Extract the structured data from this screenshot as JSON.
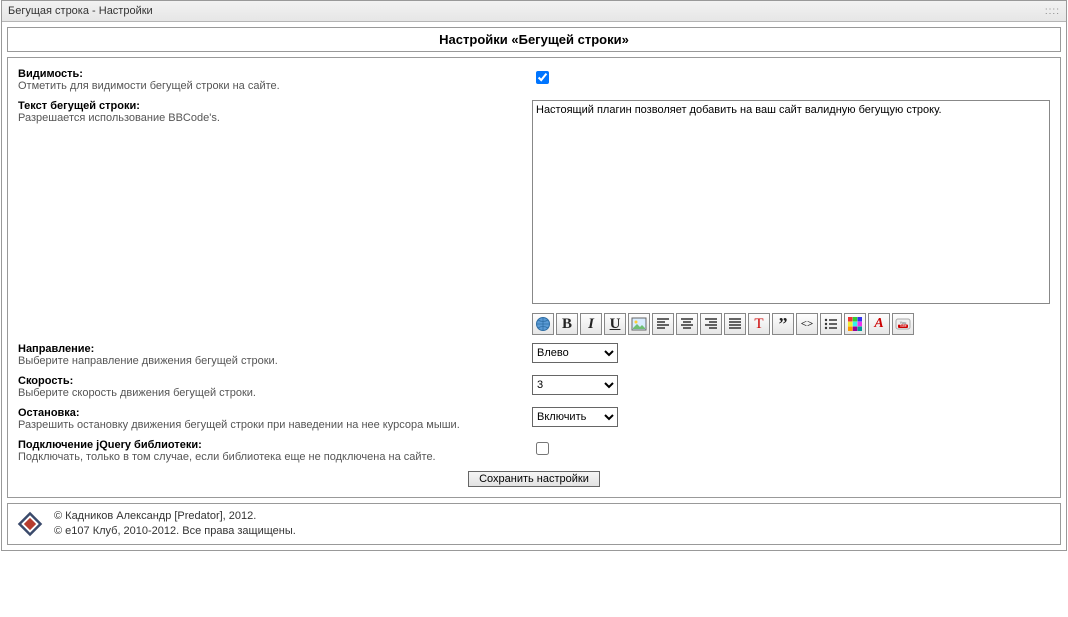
{
  "window": {
    "title": "Бегущая строка - Настройки",
    "handle": "::::"
  },
  "panel": {
    "heading": "Настройки «Бегущей строки»"
  },
  "fields": {
    "visibility": {
      "label": "Видимость:",
      "hint": "Отметить для видимости бегущей строки на сайте.",
      "checked": true
    },
    "text": {
      "label": "Текст бегущей строки:",
      "hint": "Разрешается использование BBCode's.",
      "value": "Настоящий плагин позволяет добавить на ваш сайт валидную бегущую строку."
    },
    "direction": {
      "label": "Направление:",
      "hint": "Выберите направление движения бегущей строки.",
      "value": "Влево"
    },
    "speed": {
      "label": "Скорость:",
      "hint": "Выберите скорость движения бегущей строки.",
      "value": "3"
    },
    "pause": {
      "label": "Остановка:",
      "hint": "Разрешить остановку движения бегущей строки при наведении на нее курсора мыши.",
      "value": "Включить"
    },
    "jquery": {
      "label": "Подключение jQuery библиотеки:",
      "hint": "Подключать, только в том случае, если библиотека еще не подключена на сайте.",
      "checked": false
    }
  },
  "toolbar": {
    "items": [
      {
        "name": "link-icon",
        "glyph": "globe"
      },
      {
        "name": "bold-icon",
        "glyph": "B",
        "style": "font-weight:bold;font-size:15px;"
      },
      {
        "name": "italic-icon",
        "glyph": "I",
        "style": "font-style:italic;font-weight:bold;font-size:15px;"
      },
      {
        "name": "underline-icon",
        "glyph": "U",
        "style": "text-decoration:underline;font-weight:bold;font-size:15px;"
      },
      {
        "name": "image-icon",
        "glyph": "image"
      },
      {
        "name": "align-left-icon",
        "glyph": "align-left"
      },
      {
        "name": "align-center-icon",
        "glyph": "align-center"
      },
      {
        "name": "align-right-icon",
        "glyph": "align-right"
      },
      {
        "name": "align-justify-icon",
        "glyph": "align-justify"
      },
      {
        "name": "text-style-icon",
        "glyph": "T",
        "style": "color:#c00;font-family:serif;font-size:15px;"
      },
      {
        "name": "quote-icon",
        "glyph": "”",
        "style": "font-size:18px;font-weight:bold;line-height:10px;"
      },
      {
        "name": "code-icon",
        "glyph": "<>",
        "style": "font-weight:bold;font-size:11px;font-family:Verdana;"
      },
      {
        "name": "list-icon",
        "glyph": "list"
      },
      {
        "name": "color-icon",
        "glyph": "color"
      },
      {
        "name": "font-clear-icon",
        "glyph": "A",
        "style": "color:#c00;font-style:italic;font-weight:bold;font-size:14px;"
      },
      {
        "name": "youtube-icon",
        "glyph": "youtube"
      }
    ]
  },
  "buttons": {
    "save": "Сохранить настройки"
  },
  "footer": {
    "line1": "© Кадников Александр [Predator], 2012.",
    "line2": "© e107 Клуб, 2010-2012. Все права защищены."
  }
}
